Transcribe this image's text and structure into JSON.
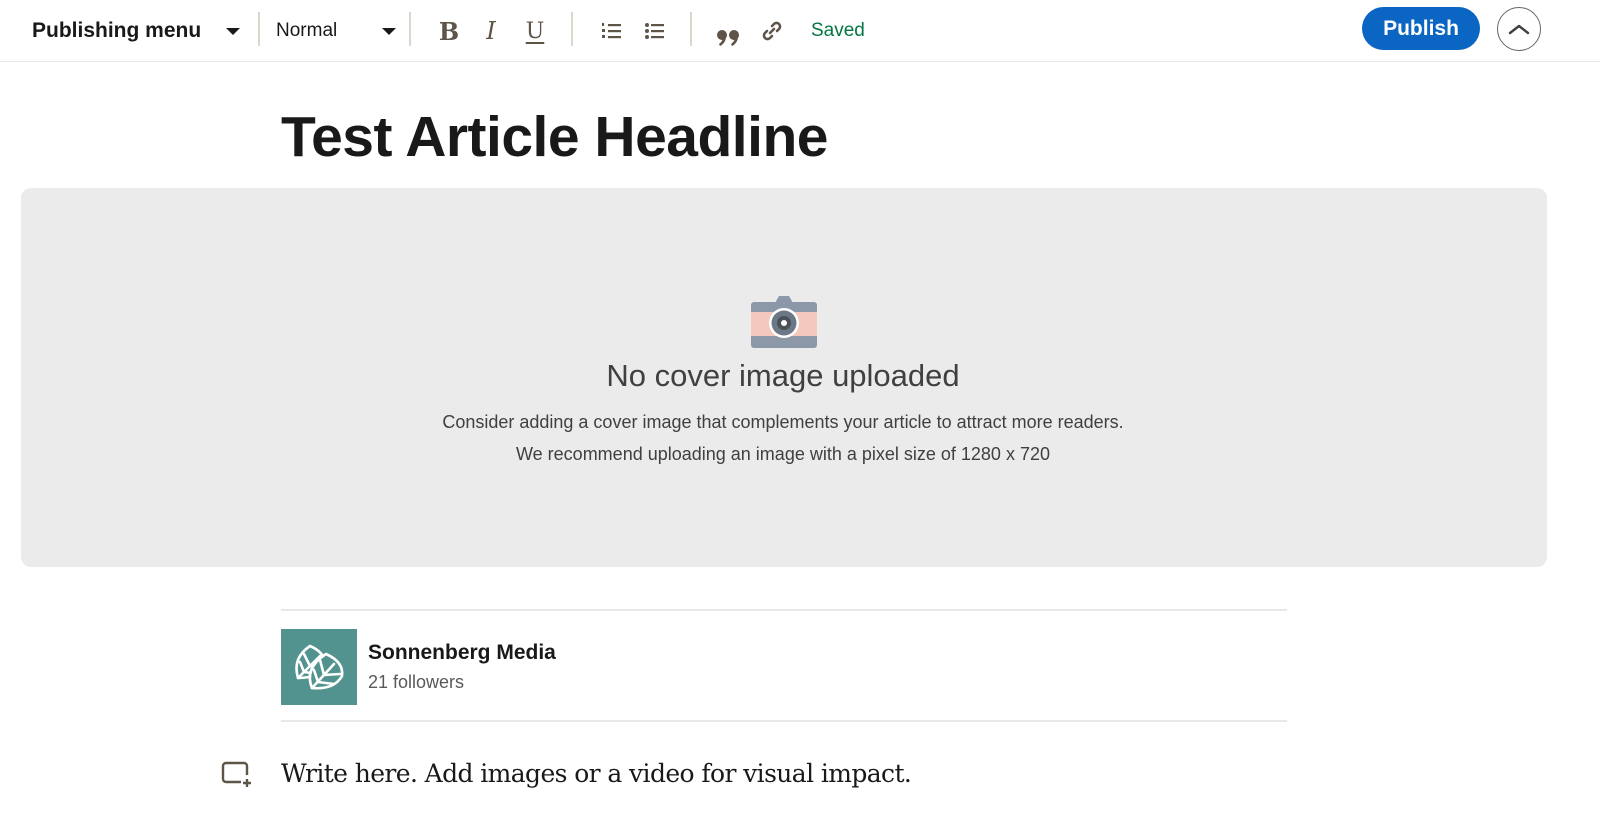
{
  "toolbar": {
    "publishing_menu_label": "Publishing menu",
    "text_style_selected": "Normal",
    "bold_label": "B",
    "italic_label": "I",
    "underline_label": "U",
    "quote_label": "”",
    "save_status": "Saved",
    "publish_label": "Publish",
    "save_status_color": "#057642",
    "publish_color": "#0a66c2"
  },
  "article": {
    "headline": "Test Article Headline",
    "cover": {
      "title": "No cover image uploaded",
      "description_line1": "Consider adding a cover image that complements your article to attract more readers.",
      "description_line2": "We recommend uploading an image with a pixel size of 1280 x 720"
    },
    "author": {
      "name": "Sonnenberg Media",
      "followers": "21 followers",
      "logo_color": "#52938f"
    },
    "body_placeholder": "Write here. Add images or a video for visual impact."
  }
}
